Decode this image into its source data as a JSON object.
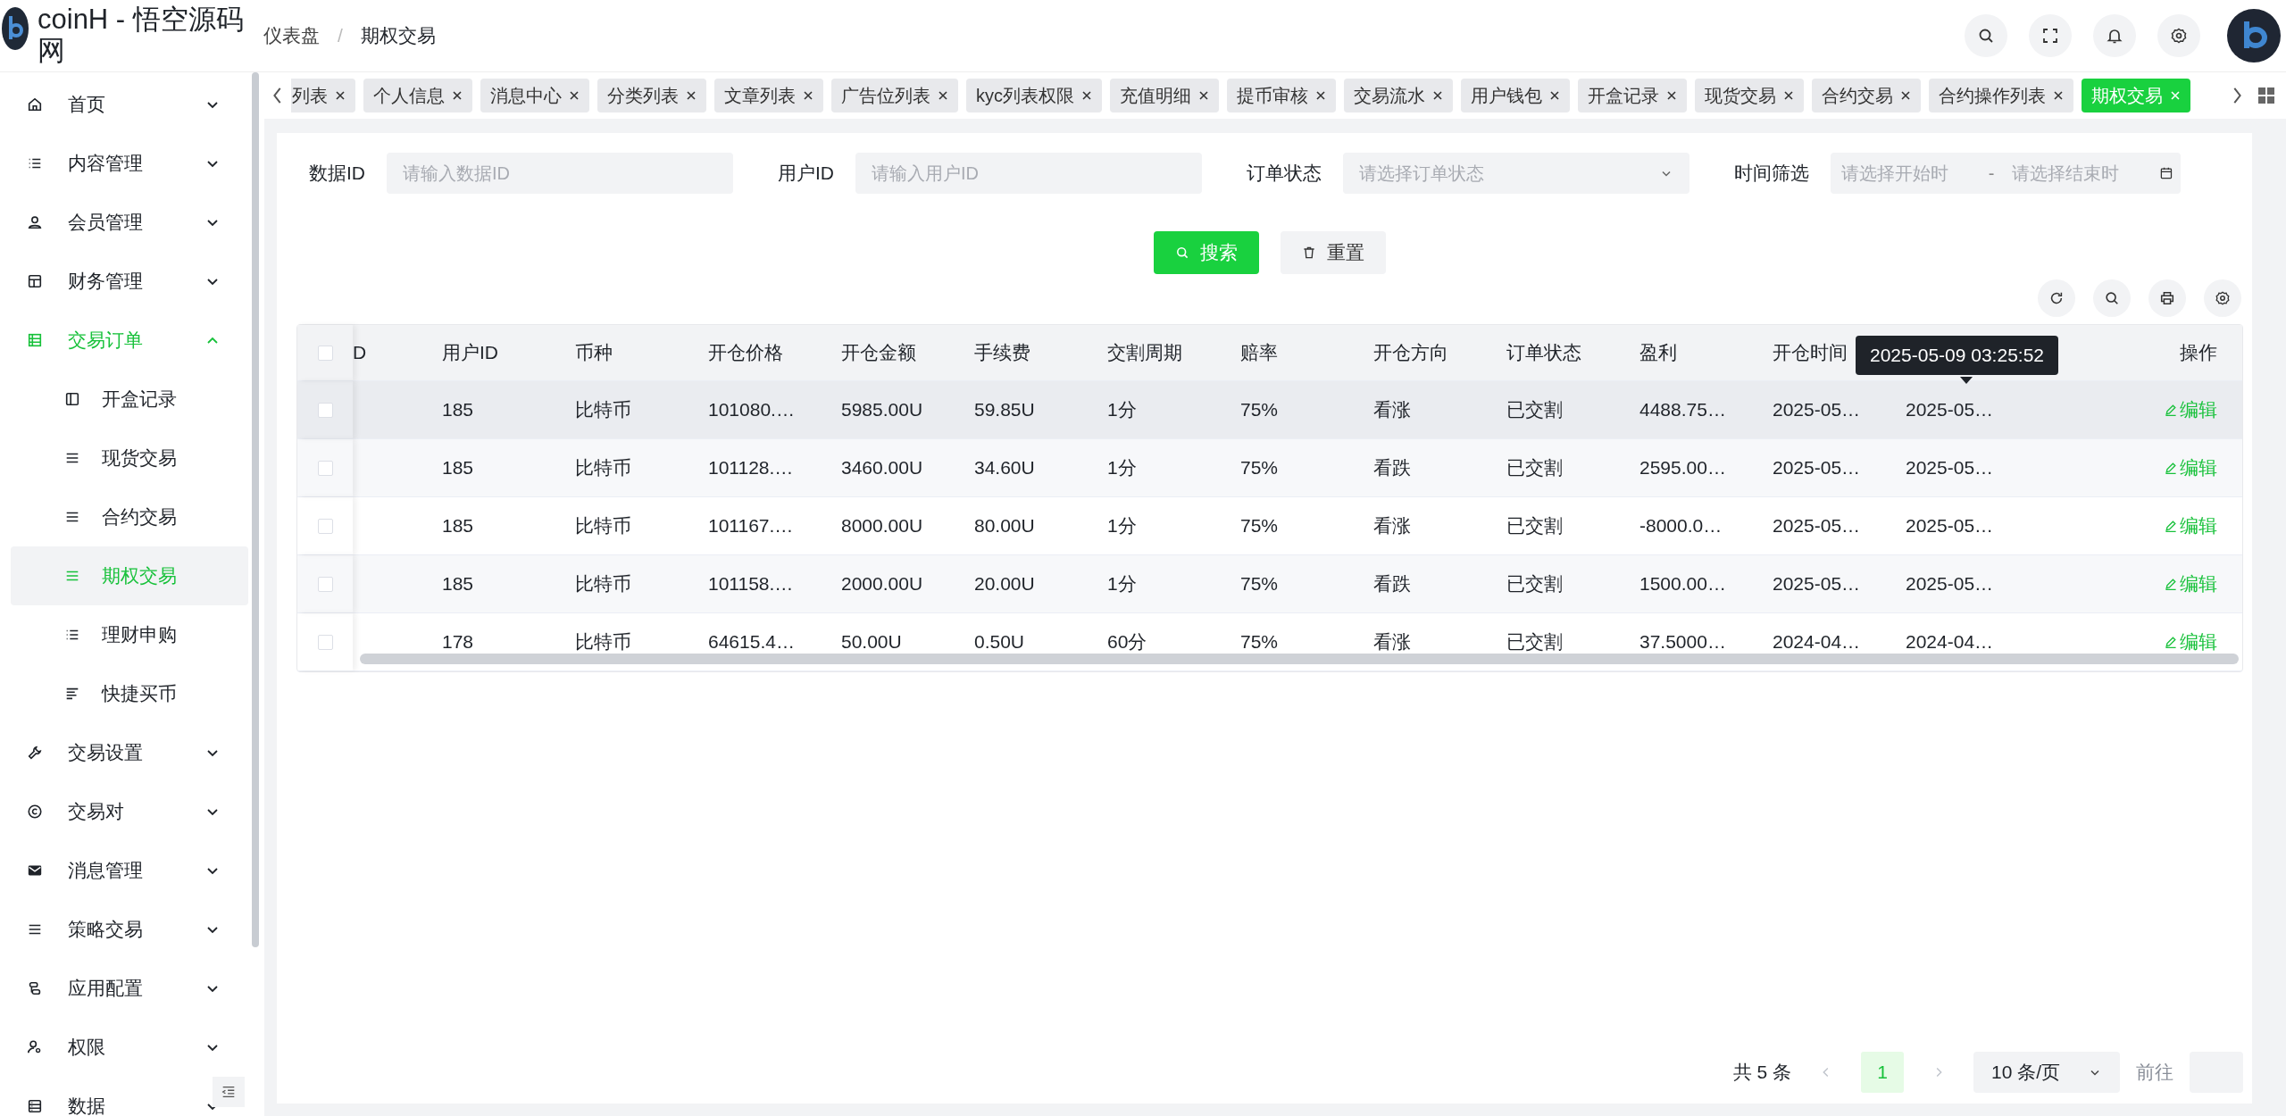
{
  "header": {
    "title": "coinH - 悟空源码网",
    "breadcrumb": [
      "仪表盘",
      "期权交易"
    ],
    "breadcrumb_separator": "/"
  },
  "sidebar": {
    "items": [
      {
        "label": "首页",
        "expanded": false
      },
      {
        "label": "内容管理",
        "expanded": false
      },
      {
        "label": "会员管理",
        "expanded": false
      },
      {
        "label": "财务管理",
        "expanded": false
      },
      {
        "label": "交易订单",
        "expanded": true,
        "children": [
          {
            "label": "开盒记录",
            "selected": false
          },
          {
            "label": "现货交易",
            "selected": false
          },
          {
            "label": "合约交易",
            "selected": false
          },
          {
            "label": "期权交易",
            "selected": true
          },
          {
            "label": "理财申购",
            "selected": false
          },
          {
            "label": "快捷买币",
            "selected": false
          }
        ]
      },
      {
        "label": "交易设置",
        "expanded": false
      },
      {
        "label": "交易对",
        "expanded": false
      },
      {
        "label": "消息管理",
        "expanded": false
      },
      {
        "label": "策略交易",
        "expanded": false
      },
      {
        "label": "应用配置",
        "expanded": false
      },
      {
        "label": "权限",
        "expanded": false
      },
      {
        "label": "数据",
        "expanded": false
      }
    ]
  },
  "tabs": [
    {
      "label": "列表",
      "selected": false
    },
    {
      "label": "个人信息",
      "selected": false
    },
    {
      "label": "消息中心",
      "selected": false
    },
    {
      "label": "分类列表",
      "selected": false
    },
    {
      "label": "文章列表",
      "selected": false
    },
    {
      "label": "广告位列表",
      "selected": false
    },
    {
      "label": "kyc列表权限",
      "selected": false
    },
    {
      "label": "充值明细",
      "selected": false
    },
    {
      "label": "提币审核",
      "selected": false
    },
    {
      "label": "交易流水",
      "selected": false
    },
    {
      "label": "用户钱包",
      "selected": false
    },
    {
      "label": "开盒记录",
      "selected": false
    },
    {
      "label": "现货交易",
      "selected": false
    },
    {
      "label": "合约交易",
      "selected": false
    },
    {
      "label": "合约操作列表",
      "selected": false
    },
    {
      "label": "期权交易",
      "selected": true
    }
  ],
  "filters": [
    {
      "kind": "text",
      "label": "数据ID",
      "placeholder": "请输入数据ID"
    },
    {
      "kind": "text",
      "label": "用户ID",
      "placeholder": "请输入用户ID"
    },
    {
      "kind": "select",
      "label": "订单状态",
      "placeholder": "请选择订单状态"
    },
    {
      "kind": "daterange",
      "label": "时间筛选",
      "placeholder": "请选择开始时",
      "placeholder_end": "请选择结束时",
      "separator": "-"
    }
  ],
  "buttons": [
    {
      "kind": "primary",
      "label": "搜索"
    },
    {
      "kind": "default",
      "label": "重置"
    }
  ],
  "table": {
    "header_checked": false,
    "columns": [
      "D",
      "用户ID",
      "币种",
      "开仓价格",
      "开仓金额",
      "手续费",
      "交割周期",
      "赔率",
      "开仓方向",
      "订单状态",
      "盈利",
      "开仓时间"
    ],
    "action_column": "操作",
    "rows": [
      {
        "checked": false,
        "hovered": true,
        "cells": [
          "",
          "185",
          "比特币",
          "101080.…",
          "5985.00U",
          "59.85U",
          "1分",
          "75%",
          "看涨",
          "已交割",
          "4488.75…",
          "2025-05…",
          "2025-05…"
        ],
        "action": "编辑"
      },
      {
        "checked": false,
        "hovered": false,
        "cells": [
          "",
          "185",
          "比特币",
          "101128.…",
          "3460.00U",
          "34.60U",
          "1分",
          "75%",
          "看跌",
          "已交割",
          "2595.00…",
          "2025-05…",
          "2025-05…"
        ],
        "action": "编辑"
      },
      {
        "checked": false,
        "hovered": false,
        "cells": [
          "",
          "185",
          "比特币",
          "101167.…",
          "8000.00U",
          "80.00U",
          "1分",
          "75%",
          "看涨",
          "已交割",
          "-8000.0…",
          "2025-05…",
          "2025-05…"
        ],
        "action": "编辑"
      },
      {
        "checked": false,
        "hovered": false,
        "cells": [
          "",
          "185",
          "比特币",
          "101158.…",
          "2000.00U",
          "20.00U",
          "1分",
          "75%",
          "看跌",
          "已交割",
          "1500.00…",
          "2025-05…",
          "2025-05…"
        ],
        "action": "编辑"
      },
      {
        "checked": false,
        "hovered": false,
        "cells": [
          "",
          "178",
          "比特币",
          "64615.4…",
          "50.00U",
          "0.50U",
          "60分",
          "75%",
          "看涨",
          "已交割",
          "37.5000…",
          "2024-04…",
          "2024-04…"
        ],
        "action": "编辑"
      }
    ],
    "tooltip": "2025-05-09 03:25:52"
  },
  "pagination": {
    "total": "共 5 条",
    "pages": [
      {
        "label": "1",
        "selected": true
      }
    ],
    "page_size": "10 条/页",
    "goto": "前往"
  }
}
